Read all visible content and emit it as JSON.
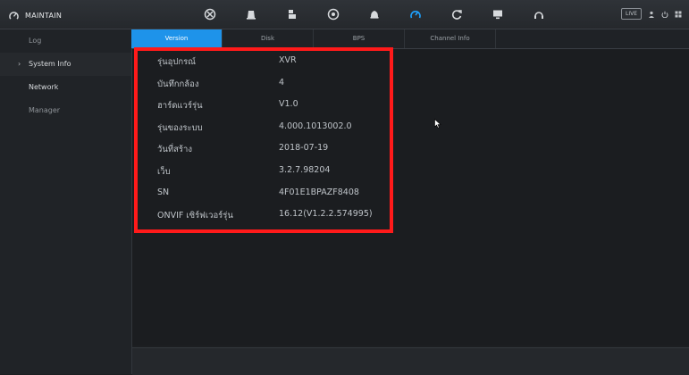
{
  "header": {
    "title": "MAINTAIN",
    "nav_icons": [
      "target-icon",
      "live-icon",
      "storage-icon",
      "network-icon",
      "alarm-icon",
      "maintain-icon",
      "backup-icon",
      "display-icon",
      "audio-icon"
    ],
    "active_icon": "maintain-icon",
    "live_label": "LIVE"
  },
  "sidebar": {
    "items": [
      {
        "label": "Log"
      },
      {
        "label": "System Info"
      },
      {
        "label": "Network"
      },
      {
        "label": "Manager"
      }
    ]
  },
  "tabs": [
    {
      "label": "Version"
    },
    {
      "label": "Disk"
    },
    {
      "label": "BPS"
    },
    {
      "label": "Channel Info"
    }
  ],
  "version_info": [
    {
      "key": "รุ่นอุปกรณ์",
      "value": "XVR"
    },
    {
      "key": "บันทึกกล้อง",
      "value": "4"
    },
    {
      "key": "ฮาร์ดแวร์รุ่น",
      "value": "V1.0"
    },
    {
      "key": "รุ่นของระบบ",
      "value": "4.000.1013002.0"
    },
    {
      "key": "วันที่สร้าง",
      "value": "2018-07-19"
    },
    {
      "key": "เว็บ",
      "value": "3.2.7.98204"
    },
    {
      "key": "SN",
      "value": "4F01E1BPAZF8408"
    },
    {
      "key": "ONVIF เซิร์ฟเวอร์รุ่น",
      "value": "16.12(V1.2.2.574995)"
    }
  ],
  "colors": {
    "accent": "#1e93ea",
    "highlight": "#ff1a1a"
  }
}
